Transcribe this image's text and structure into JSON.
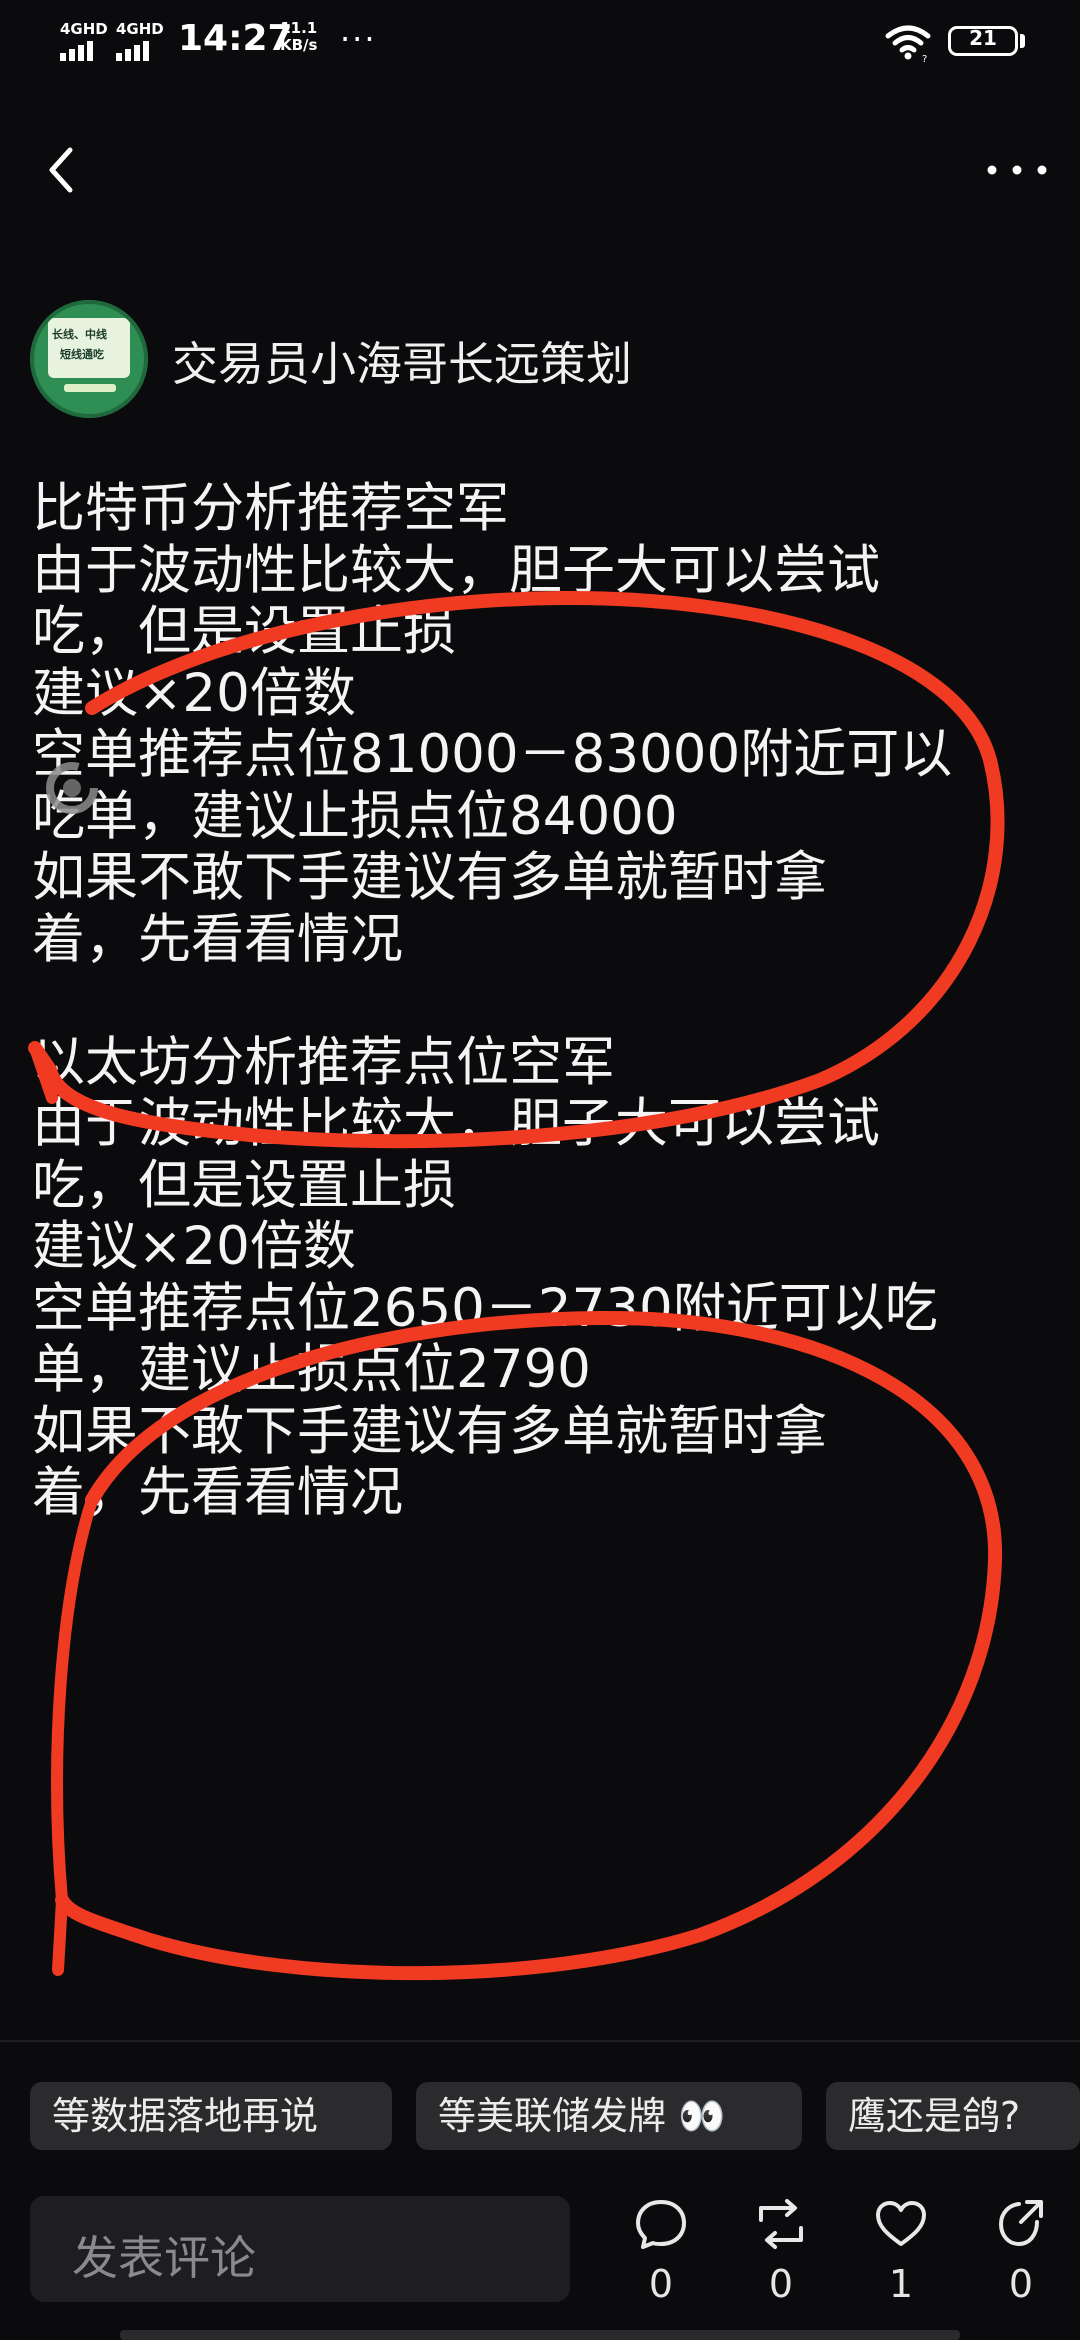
{
  "status_bar": {
    "sim1": "4GHD",
    "sim2": "4GHD",
    "time": "14:27",
    "net_speed_value": "11.1",
    "net_speed_unit": "KB/s",
    "more_dots": "···",
    "battery": "21"
  },
  "author": {
    "avatar_line1": "长线、中线",
    "avatar_line2": "短线通吃",
    "name": "交易员小海哥长远策划"
  },
  "post": {
    "lines": [
      "比特币分析推荐空军",
      "由于波动性比较大，胆子大可以尝试",
      "吃，但是设置止损",
      "建议×20倍数",
      "空单推荐点位81000－83000附近可以",
      "吃单，建议止损点位84000",
      "如果不敢下手建议有多单就暂时拿",
      "着，先看看情况",
      "",
      "以太坊分析推荐点位空军",
      "由于波动性比较大，胆子大可以尝试",
      "吃，但是设置止损",
      "建议×20倍数",
      "空单推荐点位2650－2730附近可以吃",
      "单，建议止损点位2790",
      "如果不敢下手建议有多单就暂时拿",
      "着，先看看情况"
    ]
  },
  "tags": [
    "等数据落地再说",
    "等美联储发牌 👀",
    "鹰还是鸽?"
  ],
  "bottom_bar": {
    "comment_placeholder": "发表评论",
    "comment_count": "0",
    "repost_count": "0",
    "like_count": "1",
    "share_count": "0"
  },
  "colors": {
    "background": "#0b0b0d",
    "annotation_red": "#f03a22",
    "tag_bg": "#2b2b2e"
  },
  "icons": [
    "back-arrow-icon",
    "more-options-icon",
    "comment-icon",
    "repost-icon",
    "like-heart-icon",
    "share-icon",
    "wifi-icon",
    "battery-icon",
    "loading-spinner-icon"
  ]
}
